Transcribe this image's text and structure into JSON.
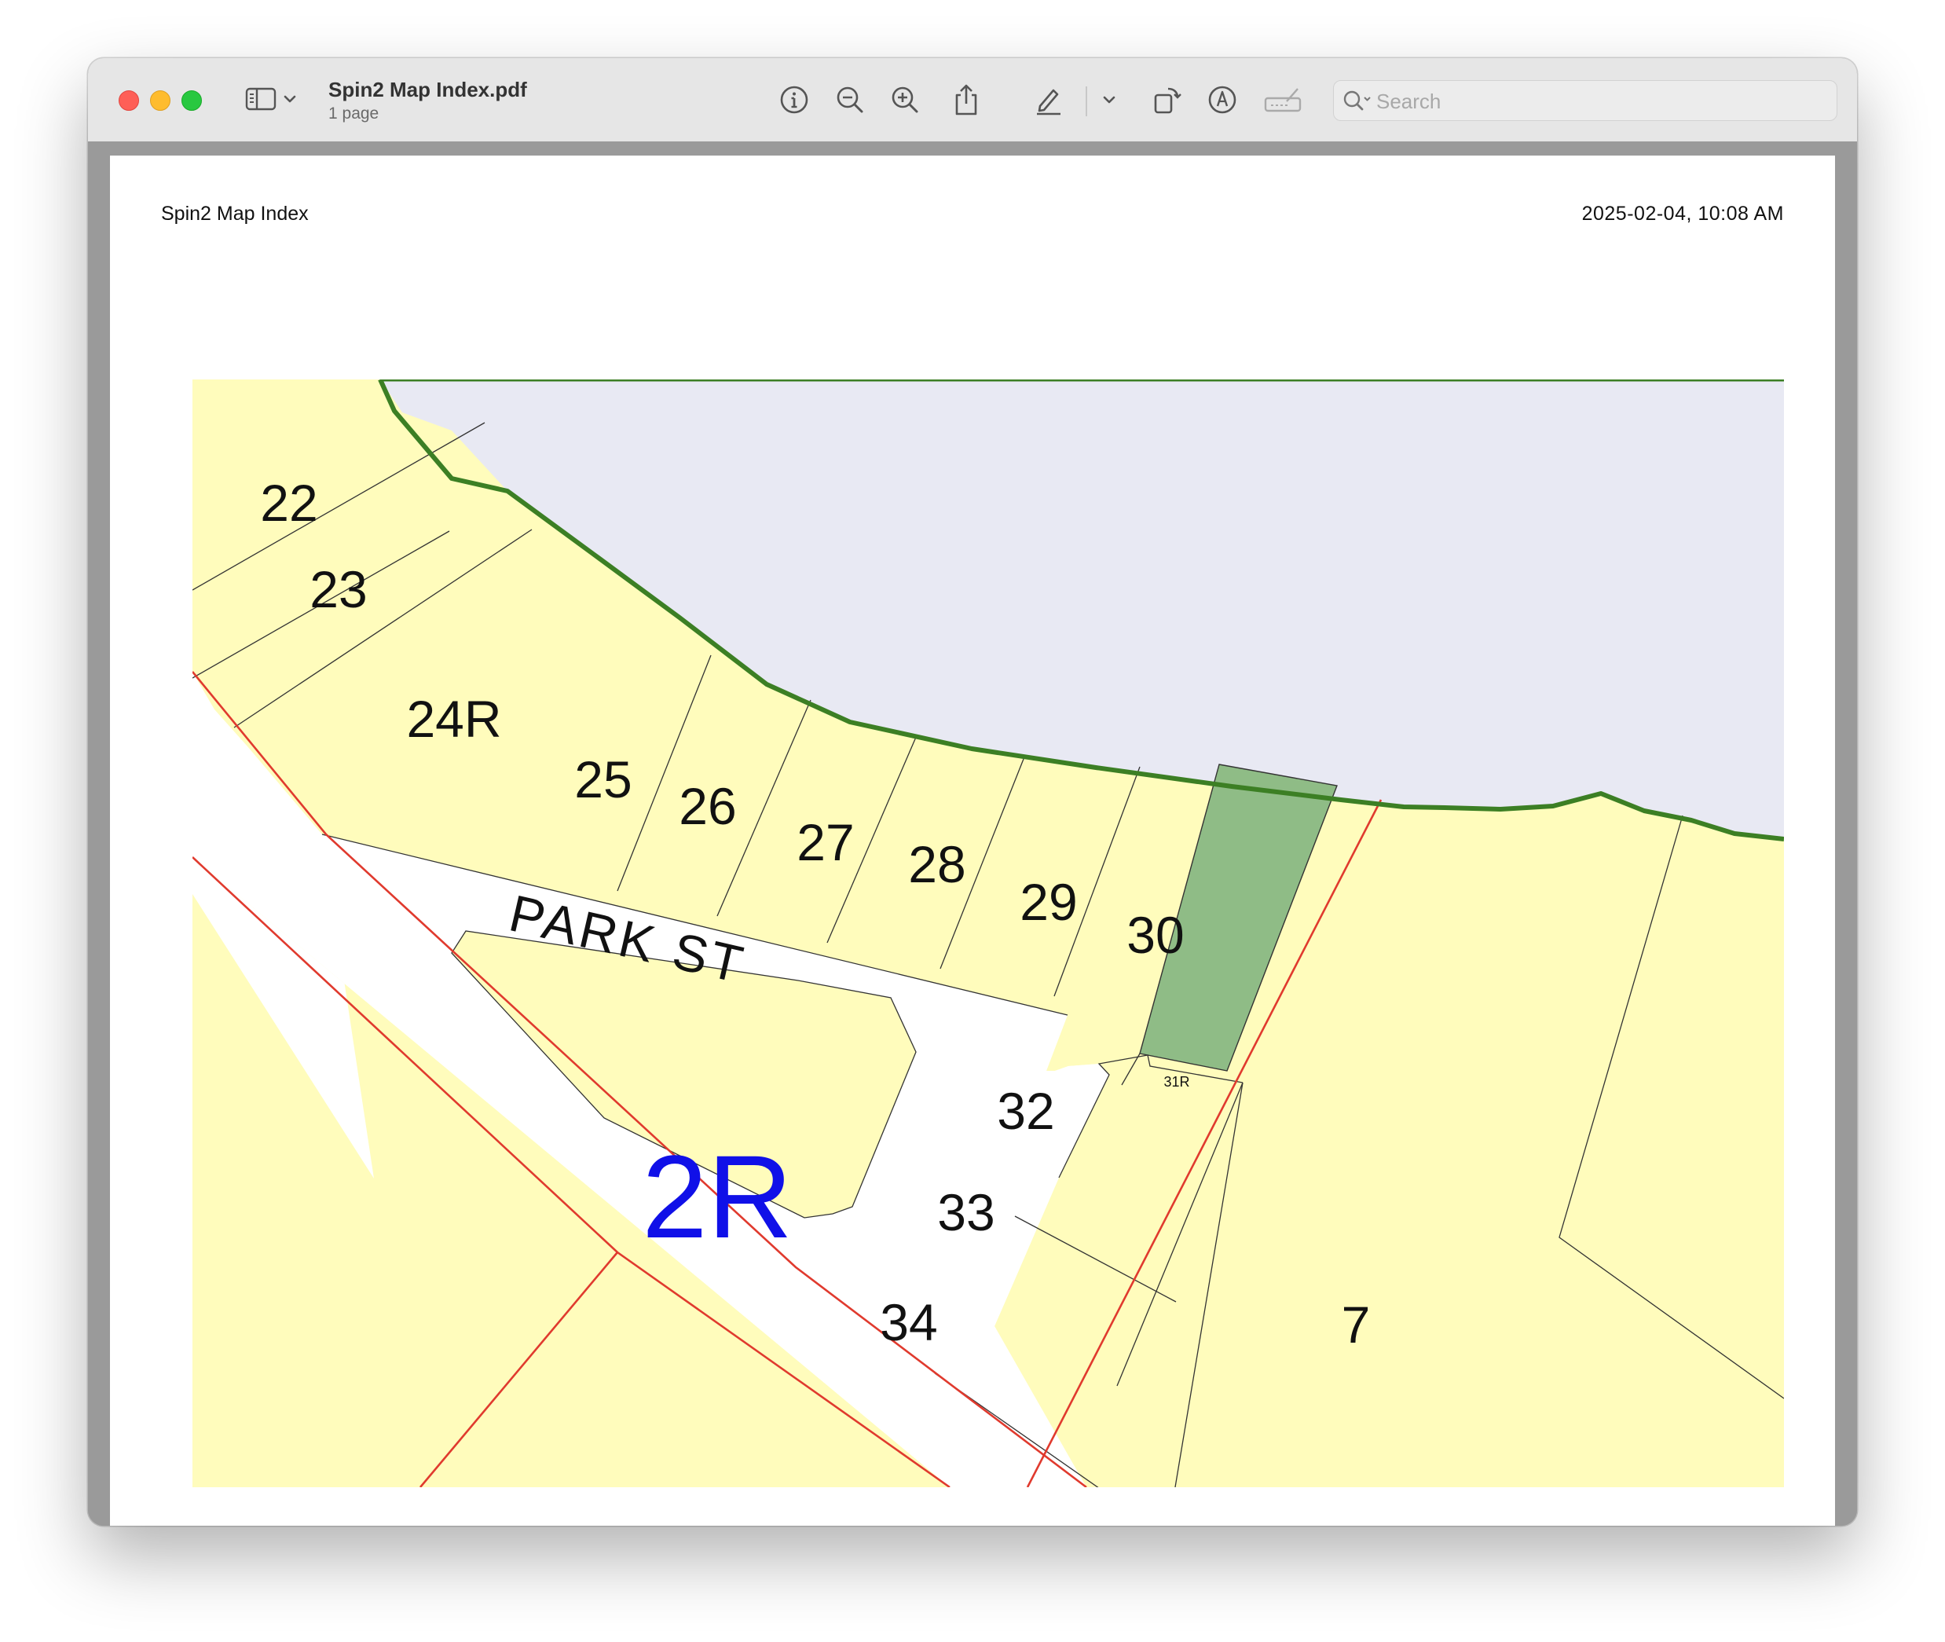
{
  "window": {
    "title": "Spin2 Map Index.pdf",
    "subtitle": "1 page",
    "controls": {
      "close": "close-button",
      "minimize": "minimize-button",
      "zoom": "zoom-button"
    }
  },
  "toolbar": {
    "icons": [
      "sidebar-icon",
      "chevron-down-icon",
      "info-icon",
      "zoom-out-icon",
      "zoom-in-icon",
      "share-icon",
      "highlight-pen-icon",
      "chevron-down-icon",
      "rotate-icon",
      "markup-icon",
      "signature-icon"
    ],
    "search": {
      "placeholder": "Search",
      "value": ""
    }
  },
  "page": {
    "header_left": "Spin2 Map Index",
    "header_right": "2025-02-04, 10:08 AM"
  },
  "map": {
    "street_label": "PARK ST",
    "highlighted_lot": "30",
    "colors": {
      "parcel_fill": "#fffcbc",
      "highlight_fill": "#8fbc86",
      "water_fill": "#e8e9f3",
      "shoreline": "#3c7f24",
      "boundary_red": "#e03a2e",
      "road_fill": "#ffffff",
      "block_label": "#1010e8"
    },
    "lots": {
      "l22": "22",
      "l23": "23",
      "l24r": "24R",
      "l25": "25",
      "l26": "26",
      "l27": "27",
      "l28": "28",
      "l29": "29",
      "l30": "30",
      "l31r": "31R",
      "l32": "32",
      "l33": "33",
      "l34": "34",
      "l7": "7",
      "l2r": "2R"
    }
  }
}
